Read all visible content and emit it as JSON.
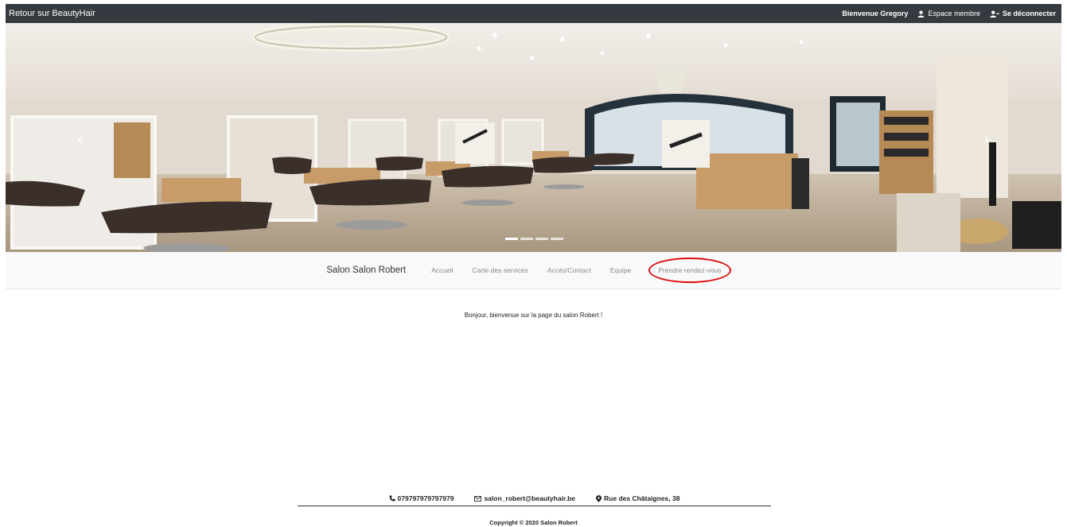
{
  "topbar": {
    "brand": "Retour sur BeautyHair",
    "welcome": "Bienvenue Gregory",
    "member_space": "Espace membre",
    "logout": "Se déconnecter"
  },
  "carousel": {
    "slide_count": 4,
    "active_index": 0,
    "prev_icon": "chevron-left-icon",
    "next_icon": "chevron-right-icon"
  },
  "nav": {
    "salon_name": "Salon Salon Robert",
    "links": [
      "Accueil",
      "Carte des services",
      "Accès/Contact",
      "Equipe",
      "Prendre rendez-vous"
    ],
    "highlight_color": "#e10d0d"
  },
  "main": {
    "welcome": "Bonjour, bienvenue sur la page du salon Robert !"
  },
  "footer": {
    "phone": "079797979797979",
    "email": "salon_robert@beautyhair.be",
    "address": "Rue des Châtaignes, 38",
    "copyright": "Copyright © 2020 Salon Robert"
  },
  "colors": {
    "topbar_bg": "#343a40",
    "nav_bg": "#f8f9fa"
  }
}
